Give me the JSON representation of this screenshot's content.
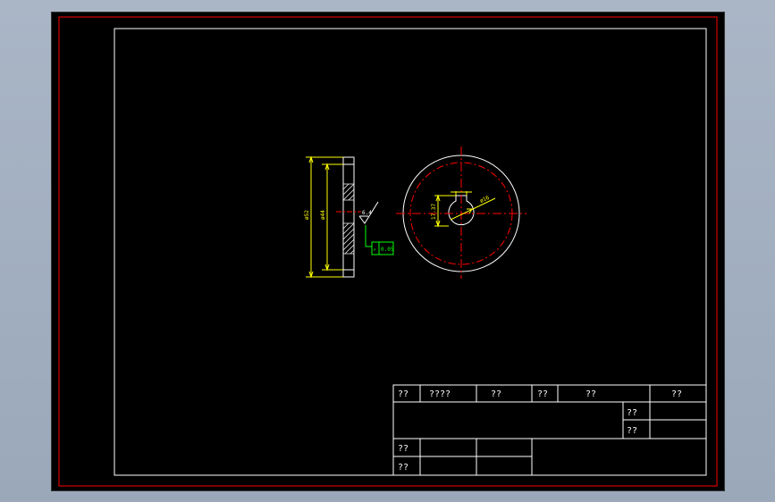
{
  "colors": {
    "background": "#000000",
    "frame_outer": "#ff0000",
    "frame_inner": "#ffffff",
    "centerline": "#ff0000",
    "dimension": "#ffff00",
    "tolerance": "#00ff00",
    "hatch": "#ffffff"
  },
  "side_view": {
    "dim_outer": "ø52",
    "dim_inner": "ø44",
    "roughness": "6.4",
    "tolerance_symbol": "↗",
    "tolerance_value": "0.05"
  },
  "front_view": {
    "dim_bore": "ø16",
    "dim_keyway": "17.37"
  },
  "title_block": {
    "row1": [
      "??",
      "????",
      "??",
      "??",
      "??",
      "??"
    ],
    "mid_labels": [
      "??",
      "??"
    ],
    "bottom_labels": [
      "??",
      "??"
    ]
  }
}
